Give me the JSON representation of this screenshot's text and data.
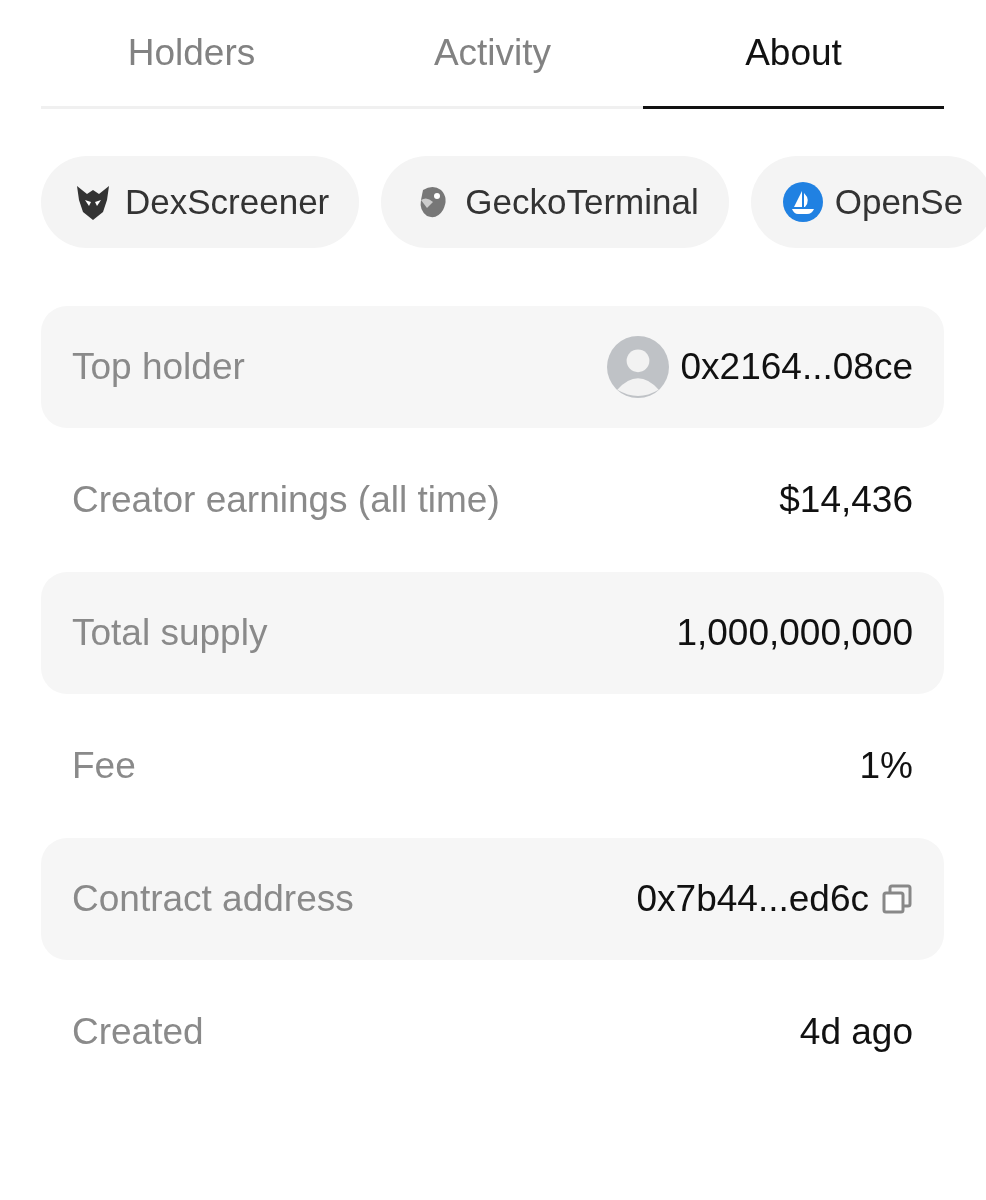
{
  "tabs": [
    {
      "label": "Holders",
      "selected": false
    },
    {
      "label": "Activity",
      "selected": false
    },
    {
      "label": "About",
      "selected": true
    }
  ],
  "links": [
    {
      "label": "DexScreener",
      "kind": "owl"
    },
    {
      "label": "GeckoTerminal",
      "kind": "gecko"
    },
    {
      "label": "OpenSe",
      "kind": "boat"
    }
  ],
  "details": [
    {
      "label": "Top holder",
      "value": "0x2164...08ce",
      "kind": "avatar"
    },
    {
      "label": "Creator earnings (all time)",
      "value": "$14,436",
      "kind": "plain"
    },
    {
      "label": "Total supply",
      "value": "1,000,000,000",
      "kind": "plain"
    },
    {
      "label": "Fee",
      "value": "1%",
      "kind": "plain"
    },
    {
      "label": "Contract address",
      "value": "0x7b44...ed6c",
      "kind": "copy"
    },
    {
      "label": "Created",
      "value": "4d ago",
      "kind": "plain"
    }
  ]
}
